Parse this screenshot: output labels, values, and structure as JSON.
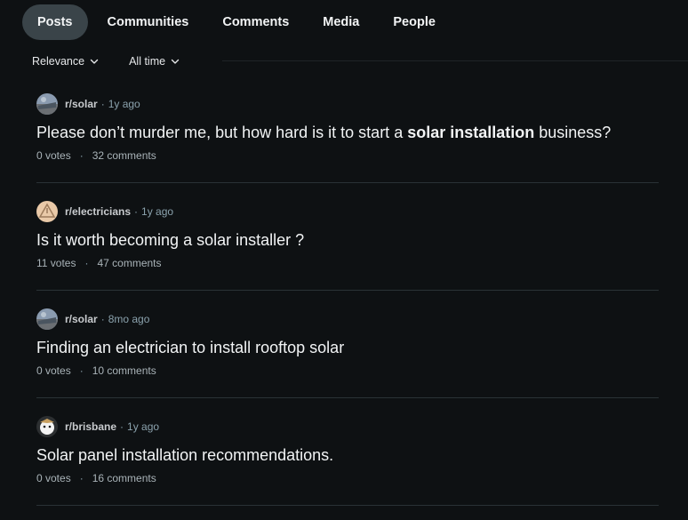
{
  "tabs": [
    {
      "label": "Posts",
      "active": true
    },
    {
      "label": "Communities",
      "active": false
    },
    {
      "label": "Comments",
      "active": false
    },
    {
      "label": "Media",
      "active": false
    },
    {
      "label": "People",
      "active": false
    }
  ],
  "filters": {
    "sort": "Relevance",
    "time": "All time"
  },
  "posts": [
    {
      "subreddit": "r/solar",
      "age": "1y ago",
      "title_before": "Please don’t murder me, but how hard is it to start a ",
      "title_highlight": "solar installation",
      "title_after": " business?",
      "votes": "0 votes",
      "comments": "32 comments",
      "avatar_icon": "solar-avatar-icon"
    },
    {
      "subreddit": "r/electricians",
      "age": "1y ago",
      "title_before": "Is it worth becoming a solar installer ?",
      "title_highlight": "",
      "title_after": "",
      "votes": "11 votes",
      "comments": "47 comments",
      "avatar_icon": "electricians-avatar-icon"
    },
    {
      "subreddit": "r/solar",
      "age": "8mo ago",
      "title_before": "Finding an electrician to install rooftop solar",
      "title_highlight": "",
      "title_after": "",
      "votes": "0 votes",
      "comments": "10 comments",
      "avatar_icon": "solar-avatar-icon"
    },
    {
      "subreddit": "r/brisbane",
      "age": "1y ago",
      "title_before": "Solar panel installation recommendations.",
      "title_highlight": "",
      "title_after": "",
      "votes": "0 votes",
      "comments": "16 comments",
      "avatar_icon": "brisbane-avatar-icon"
    }
  ],
  "separator": "·",
  "colors": {
    "background": "#0e1113",
    "active_tab": "#3a4449",
    "divider": "#2a3236",
    "meta_text": "#8ba2ad"
  }
}
